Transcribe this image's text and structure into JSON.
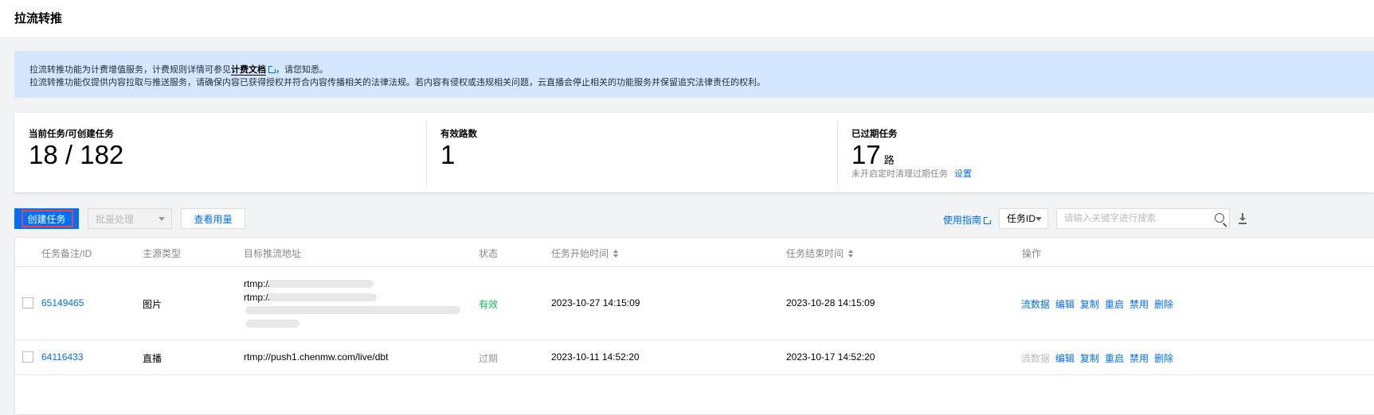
{
  "header": {
    "title": "拉流转推"
  },
  "notice": {
    "line1_prefix": "拉流转推功能为计费增值服务，计费规则详情可参见",
    "line1_link": "计费文档",
    "line1_suffix": "，请您知悉。",
    "line2": "拉流转推功能仅提供内容拉取与推送服务，请确保内容已获得授权并符合内容传播相关的法律法规。若内容有侵权或违规相关问题，云直播会停止相关的功能服务并保留追究法律责任的权利。"
  },
  "stats": {
    "current": {
      "label": "当前任务/可创建任务",
      "value": "18 / 182"
    },
    "valid": {
      "label": "有效路数",
      "value": "1"
    },
    "expired": {
      "label": "已过期任务",
      "value": "17",
      "unit": "路",
      "sub": "未开启定时清理过期任务",
      "sub_link": "设置"
    }
  },
  "toolbar": {
    "create_label": "创建任务",
    "batch_label": "批量处理",
    "usage_label": "查看用量",
    "guide_label": "使用指南",
    "select_value": "任务ID",
    "search_placeholder": "请输入关键字进行搜索"
  },
  "table": {
    "headers": [
      "任务备注/ID",
      "主源类型",
      "目标推流地址",
      "状态",
      "任务开始时间",
      "任务结束时间",
      "操作"
    ],
    "rows": [
      {
        "id": "65149465",
        "type": "图片",
        "addr_lines": [
          "rtmp://",
          "rtmp://"
        ],
        "status": "有效",
        "start": "2023-10-27 14:15:09",
        "end": "2023-10-28 14:15:09",
        "ops": [
          "流数据",
          "编辑",
          "复制",
          "重启",
          "禁用",
          "删除"
        ]
      },
      {
        "id": "64116433",
        "type": "直播",
        "addr": "rtmp://push1.chenmw.com/live/dbt",
        "status": "过期",
        "start": "2023-10-11 14:52:20",
        "end": "2023-10-17 14:52:20",
        "ops": [
          "流数据",
          "编辑",
          "复制",
          "重启",
          "禁用",
          "删除"
        ]
      }
    ]
  },
  "colors": {
    "accent": "#006eff",
    "notice_bg": "#d5e7ff",
    "status_ok": "#0abf5b",
    "highlight": "#e54545"
  }
}
